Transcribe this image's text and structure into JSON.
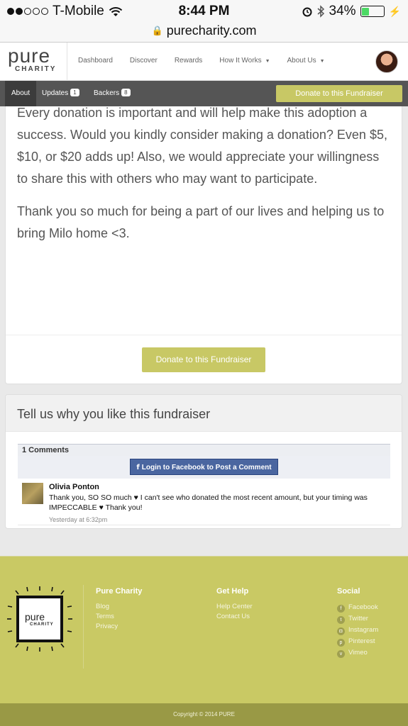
{
  "status_bar": {
    "carrier": "T-Mobile",
    "signal_dots": 5,
    "signal_filled": 2,
    "time": "8:44 PM",
    "battery": "34%",
    "battery_level": 0.34,
    "battery_color": "#4cd964"
  },
  "browser": {
    "url": "purecharity.com"
  },
  "header": {
    "logo_top": "pure",
    "logo_bottom": "CHARITY",
    "nav": [
      {
        "label": "Dashboard"
      },
      {
        "label": "Discover"
      },
      {
        "label": "Rewards"
      },
      {
        "label": "How It Works",
        "dropdown": true
      },
      {
        "label": "About Us",
        "dropdown": true
      }
    ]
  },
  "subnav": {
    "tabs": [
      {
        "label": "About",
        "active": true
      },
      {
        "label": "Updates",
        "badge": "1"
      },
      {
        "label": "Backers",
        "badge": "8"
      }
    ],
    "donate_label": "Donate to this Fundraiser"
  },
  "story": {
    "paragraphs": [
      "Every donation is important and will help make this adoption a success. Would you kindly consider making a donation? Even $5, $10, or $20 adds up!  Also, we would appreciate your willingness to share this with others who may want to participate.",
      "Thank you so much for being a part of our lives and helping us to bring Milo home <3."
    ],
    "donate_label": "Donate to this Fundraiser"
  },
  "comments": {
    "heading": "Tell us why you like this fundraiser",
    "count_label": "1 Comments",
    "login_label": "Login to Facebook to Post a Comment",
    "items": [
      {
        "author": "Olivia Ponton",
        "text": "Thank you, SO SO much ♥ I can't see who donated the most recent amount, but your timing was IMPECCABLE ♥ Thank you!",
        "timestamp": "Yesterday at 6:32pm"
      }
    ]
  },
  "footer": {
    "logo_top": "pure",
    "logo_bottom": "CHARITY",
    "columns": [
      {
        "title": "Pure Charity",
        "links": [
          "Blog",
          "Terms",
          "Privacy"
        ]
      },
      {
        "title": "Get Help",
        "links": [
          "Help Center",
          "Contact Us"
        ]
      },
      {
        "title": "Social",
        "links": [
          "Facebook",
          "Twitter",
          "Instagram",
          "Pinterest",
          "Vimeo"
        ],
        "icons": [
          "facebook-icon",
          "twitter-icon",
          "instagram-icon",
          "pinterest-icon",
          "vimeo-icon"
        ]
      }
    ],
    "copyright": "Copyright © 2014 PURE"
  },
  "colors": {
    "accent": "#c8c865",
    "footer": "#c9c964",
    "subnav": "#555555",
    "facebook": "#4a66a0"
  }
}
